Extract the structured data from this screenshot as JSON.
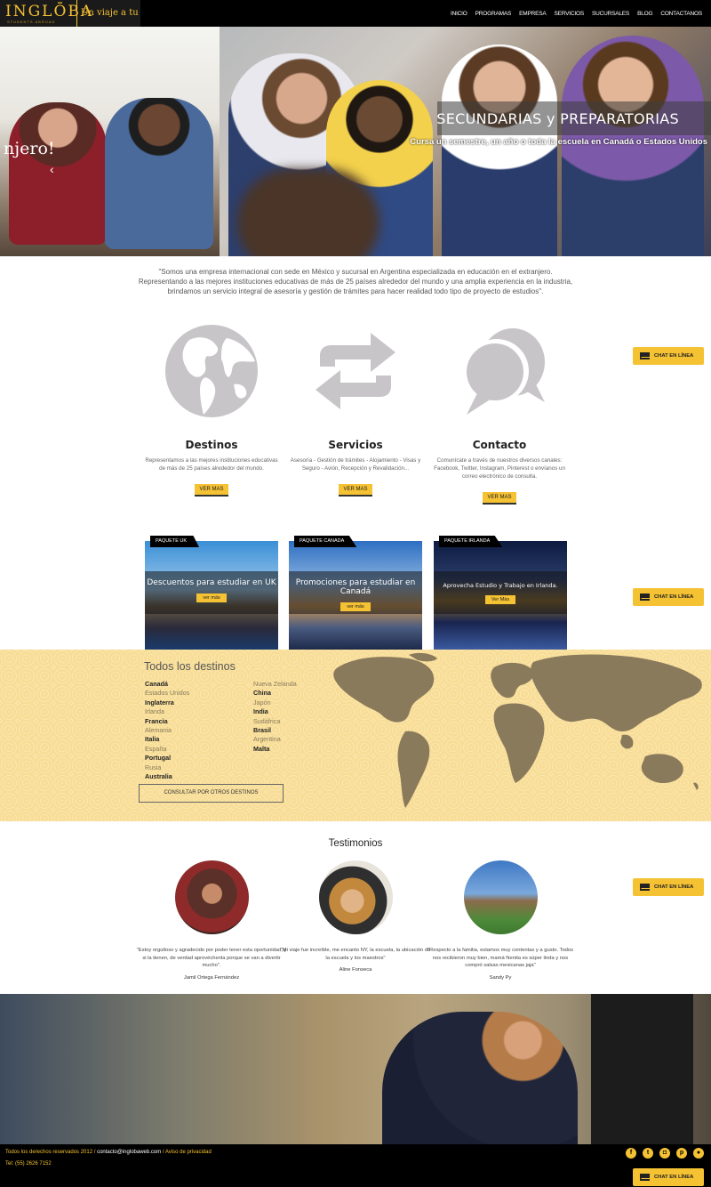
{
  "header": {
    "logo": "INGLŌBA",
    "logo_sub": "STUDENTS ABROAD",
    "tagline": "Un viaje a tu destino.",
    "nav": [
      "INICIO",
      "PROGRAMAS",
      "EMPRESA",
      "SERVICIOS",
      "SUCURSALES",
      "BLOG",
      "CONTACTANOS"
    ]
  },
  "hero": {
    "left_text": "njero!",
    "left_arrow": "‹",
    "title": "SECUNDARIAS y PREPARATORIAS",
    "subtitle": "Cursa un semestre, un año o toda la escuela en Canadá o Estados Unidos"
  },
  "intro": "\"Somos una empresa internacional con sede en México y sucursal en Argentina especializada en educación en el extranjero. Representando a las mejores instituciones educativas de más de 25 países alrededor del mundo y una amplia experiencia en la industria, brindamos un servicio integral de asesoría y gestión de trámites para hacer realidad todo tipo de proyecto de estudios\".",
  "services": [
    {
      "title": "Destinos",
      "desc": "Representamos a las mejores instituciones educativas de más de 25 países alrededor del mundo.",
      "button": "VER MAS",
      "icon": "globe-icon"
    },
    {
      "title": "Servicios",
      "desc": "Asesoría - Gestión de trámites - Alojamiento - Visas y Seguro - Avión, Recepción y Revalidación...",
      "button": "VER MAS",
      "icon": "exchange-icon"
    },
    {
      "title": "Contacto",
      "desc": "Comunícate a través de nuestros diversos canales: Facebook, Twitter, Instagram, Pinterest o envíanos un correo electrónico de consulta.",
      "button": "VER MAS",
      "icon": "chat-bubbles-icon"
    }
  ],
  "chat_label": "CHAT EN LÍNEA",
  "packages": [
    {
      "tag": "PAQUETE UK",
      "title": "Descuentos para estudiar en UK",
      "button": "ver más"
    },
    {
      "tag": "PAQUETE CANADA",
      "title": "Promociones para estudiar en Canadá",
      "button": "ver más"
    },
    {
      "tag": "PAQUETE IRLANDA",
      "title": "Aprovecha Estudio y Trabajo en Irlanda.",
      "button": "Ver Más"
    }
  ],
  "destinations": {
    "title": "Todos los destinos",
    "col1": [
      {
        "name": "Canadá",
        "bold": true
      },
      {
        "name": "Estados Unidos",
        "bold": false
      },
      {
        "name": "Inglaterra",
        "bold": true
      },
      {
        "name": "Irlanda",
        "bold": false
      },
      {
        "name": "Francia",
        "bold": true
      },
      {
        "name": "Alemania",
        "bold": false
      },
      {
        "name": "Italia",
        "bold": true
      },
      {
        "name": "España",
        "bold": false
      },
      {
        "name": "Portugal",
        "bold": true
      },
      {
        "name": "Rusia",
        "bold": false
      },
      {
        "name": "Australia",
        "bold": true
      }
    ],
    "col2": [
      {
        "name": "Nueva Zelanda",
        "bold": false
      },
      {
        "name": "China",
        "bold": true
      },
      {
        "name": "Japón",
        "bold": false
      },
      {
        "name": "India",
        "bold": true
      },
      {
        "name": "Sudáfrica",
        "bold": false
      },
      {
        "name": "Brasil",
        "bold": true
      },
      {
        "name": "Argentina",
        "bold": false
      },
      {
        "name": "Malta",
        "bold": true
      }
    ],
    "button": "CONSULTAR POR OTROS DESTINOS"
  },
  "testimonials": {
    "title": "Testimonios",
    "items": [
      {
        "quote": "\"Estoy orgulloso y agradecido por poder tener esta oportunidad, y si la tienen, de verdad aprovéchenla porque se van a divertir mucho\".",
        "author": "Jamil Ortega Fernández"
      },
      {
        "quote": "\"Mi viaje fue increíble, me encanto NY, la escuela, la ubicación de la escuela y los maestros\"",
        "author": "Aline Fonseca"
      },
      {
        "quote": "\"Respecto a la familia, estamos muy contentas y a gusto. Todos nos recibieron muy bien, mamá Nenita es súper linda y nos compró salsas mexicanas jaja\"",
        "author": "Sandy Py"
      }
    ]
  },
  "footer": {
    "rights": "Todos los derechos reservados 2012 /",
    "email": "contacto@inglobaweb.com",
    "privacy": "/ Aviso de privacidad",
    "phone": "Tel: (55) 2626 7152",
    "socials": [
      {
        "icon": "facebook-icon",
        "glyph": "f"
      },
      {
        "icon": "twitter-icon",
        "glyph": "t"
      },
      {
        "icon": "instagram-icon",
        "glyph": "◘"
      },
      {
        "icon": "pinterest-icon",
        "glyph": "p"
      },
      {
        "icon": "rss-icon",
        "glyph": "●"
      }
    ]
  },
  "colors": {
    "accent": "#f5c233",
    "map_bg": "#f8dd97",
    "map_land": "#8a7a5c",
    "dark": "#000000"
  }
}
